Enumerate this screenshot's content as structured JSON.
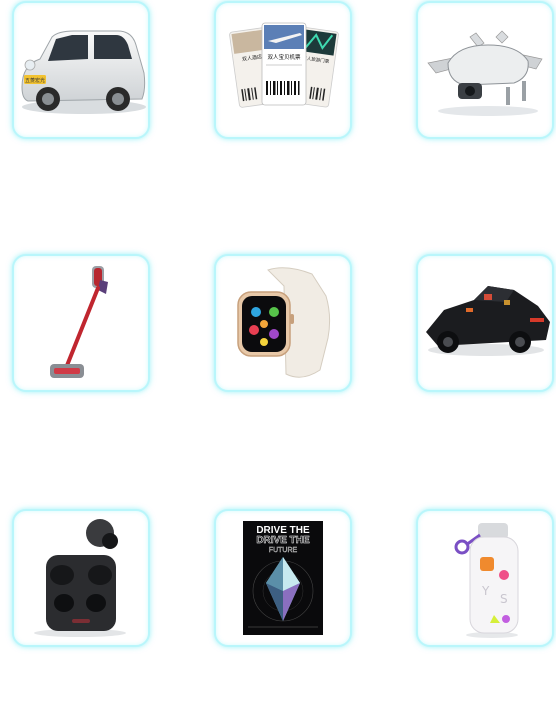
{
  "prizes": [
    {
      "icon": "electric-car-icon",
      "plate": "五菱宏光"
    },
    {
      "icon": "flight-tickets-icon",
      "ticket_text": "双人宝贝机票",
      "ticket_side_left": "双人酒店",
      "ticket_side_right": "双人旅游门票"
    },
    {
      "icon": "drone-icon"
    },
    {
      "icon": "stick-vacuum-icon"
    },
    {
      "icon": "smartwatch-icon"
    },
    {
      "icon": "toy-car-model-icon"
    },
    {
      "icon": "wireless-earbuds-icon"
    },
    {
      "icon": "poster-icon",
      "poster_title_1": "DRIVE THE",
      "poster_title_2": "DRIVE THE",
      "poster_title_3": "FUTURE"
    },
    {
      "icon": "water-bottle-icon"
    }
  ],
  "colors": {
    "card_border": "#b9f6fb",
    "card_glow": "#50e6f0"
  }
}
